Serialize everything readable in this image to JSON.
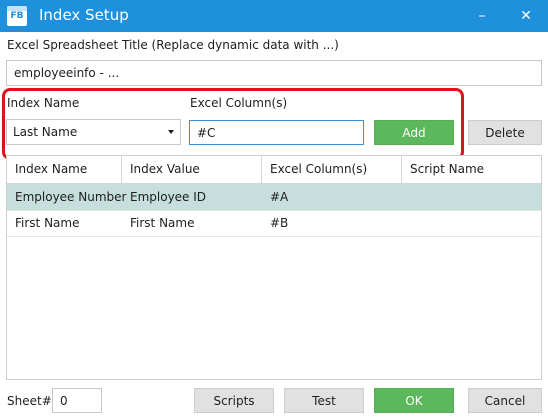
{
  "window": {
    "icon_text": "FB",
    "title": "Index Setup",
    "minimize_glyph": "–",
    "close_glyph": "✕"
  },
  "title_section": {
    "label": "Excel Spreadsheet Title  (Replace dynamic data with ...)",
    "value": "employeeinfo - ..."
  },
  "index_form": {
    "index_name_label": "Index Name",
    "excel_column_label": "Excel Column(s)",
    "index_name_selected": "Last Name",
    "excel_column_value": "#C",
    "add_label": "Add",
    "delete_label": "Delete"
  },
  "grid": {
    "columns": [
      "Index Name",
      "Index Value",
      "Excel Column(s)",
      "Script Name"
    ],
    "rows": [
      {
        "index_name": "Employee Number",
        "index_value": "Employee ID",
        "excel_column": "#A",
        "script_name": "",
        "selected": true
      },
      {
        "index_name": "First Name",
        "index_value": "First Name",
        "excel_column": "#B",
        "script_name": "",
        "selected": false
      }
    ]
  },
  "footer": {
    "sheet_label": "Sheet#",
    "sheet_value": "0",
    "scripts_label": "Scripts",
    "test_label": "Test",
    "ok_label": "OK",
    "cancel_label": "Cancel"
  },
  "colors": {
    "titlebar": "#1e90dc",
    "highlight": "#e0121b",
    "ok_green": "#5cb85c",
    "selected_row": "#c6dfdd"
  }
}
